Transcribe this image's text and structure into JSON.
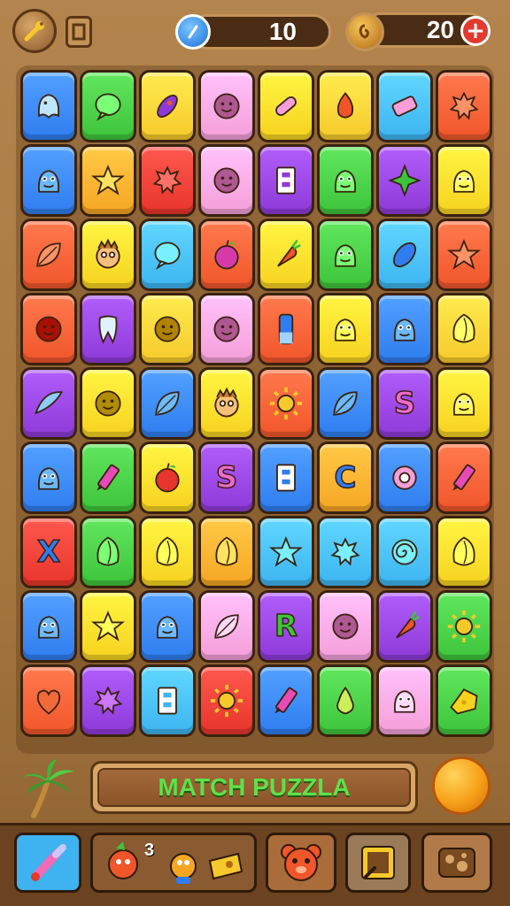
{
  "header": {
    "gems_count": "10",
    "coins_count": "20",
    "icons": [
      "wrench-icon",
      "pause-icon",
      "gem-icon",
      "coin-icon",
      "plus-icon"
    ]
  },
  "board": {
    "rows": 9,
    "cols": 8,
    "tiles": [
      [
        {
          "c": "#2f7df0",
          "i": "ghost"
        },
        {
          "c": "#3ec43a",
          "i": "bubble"
        },
        {
          "c": "#f6c92b",
          "i": "rocket"
        },
        {
          "c": "#f59ed8",
          "i": "face"
        },
        {
          "c": "#f6d21f",
          "i": "bandage"
        },
        {
          "c": "#f6c92b",
          "i": "flame"
        },
        {
          "c": "#3db4f0",
          "i": "eraser"
        },
        {
          "c": "#f0562a",
          "i": "splat"
        }
      ],
      [
        {
          "c": "#2f7df0",
          "i": "monster"
        },
        {
          "c": "#f5a623",
          "i": "star"
        },
        {
          "c": "#e8352b",
          "i": "splat"
        },
        {
          "c": "#f59ed8",
          "i": "ball"
        },
        {
          "c": "#8e3ad8",
          "i": "door"
        },
        {
          "c": "#3ec43a",
          "i": "blob"
        },
        {
          "c": "#8e3ad8",
          "i": "star4"
        },
        {
          "c": "#f6d21f",
          "i": "smile"
        }
      ],
      [
        {
          "c": "#f0562a",
          "i": "leaf"
        },
        {
          "c": "#f6d21f",
          "i": "kid"
        },
        {
          "c": "#3db4f0",
          "i": "bubble"
        },
        {
          "c": "#f0562a",
          "i": "berry"
        },
        {
          "c": "#f6d21f",
          "i": "carrot"
        },
        {
          "c": "#3ec43a",
          "i": "blob"
        },
        {
          "c": "#3db4f0",
          "i": "bean"
        },
        {
          "c": "#f0562a",
          "i": "star"
        }
      ],
      [
        {
          "c": "#f0562a",
          "i": "ball"
        },
        {
          "c": "#8e3ad8",
          "i": "tooth"
        },
        {
          "c": "#f6c92b",
          "i": "ball"
        },
        {
          "c": "#f59ed8",
          "i": "face"
        },
        {
          "c": "#f0562a",
          "i": "pill"
        },
        {
          "c": "#f6d21f",
          "i": "monster"
        },
        {
          "c": "#2f7df0",
          "i": "monster"
        },
        {
          "c": "#f6c92b",
          "i": "shell"
        }
      ],
      [
        {
          "c": "#8e3ad8",
          "i": "fish"
        },
        {
          "c": "#f6d21f",
          "i": "ball"
        },
        {
          "c": "#2f7df0",
          "i": "leaf"
        },
        {
          "c": "#f6d21f",
          "i": "lion"
        },
        {
          "c": "#f0562a",
          "i": "sun"
        },
        {
          "c": "#2f7df0",
          "i": "leaf"
        },
        {
          "c": "#8e3ad8",
          "i": "S"
        },
        {
          "c": "#f6d21f",
          "i": "monster"
        }
      ],
      [
        {
          "c": "#2f7df0",
          "i": "bird"
        },
        {
          "c": "#3ec43a",
          "i": "crayon"
        },
        {
          "c": "#f6d21f",
          "i": "apple"
        },
        {
          "c": "#8e3ad8",
          "i": "S"
        },
        {
          "c": "#2f7df0",
          "i": "door"
        },
        {
          "c": "#f5a623",
          "i": "C"
        },
        {
          "c": "#2f7df0",
          "i": "ring"
        },
        {
          "c": "#f0562a",
          "i": "crayon"
        }
      ],
      [
        {
          "c": "#e8352b",
          "i": "X"
        },
        {
          "c": "#3ec43a",
          "i": "shell"
        },
        {
          "c": "#f6d21f",
          "i": "shell"
        },
        {
          "c": "#f5a623",
          "i": "shell"
        },
        {
          "c": "#3db4f0",
          "i": "star"
        },
        {
          "c": "#3db4f0",
          "i": "flower"
        },
        {
          "c": "#3db4f0",
          "i": "spiral"
        },
        {
          "c": "#f6d21f",
          "i": "shell"
        }
      ],
      [
        {
          "c": "#2f7df0",
          "i": "blob"
        },
        {
          "c": "#f6d21f",
          "i": "star"
        },
        {
          "c": "#2f7df0",
          "i": "monster"
        },
        {
          "c": "#f59ed8",
          "i": "leaf"
        },
        {
          "c": "#8e3ad8",
          "i": "R"
        },
        {
          "c": "#f59ed8",
          "i": "ball"
        },
        {
          "c": "#8e3ad8",
          "i": "carrot"
        },
        {
          "c": "#3ec43a",
          "i": "sun"
        }
      ],
      [
        {
          "c": "#f0562a",
          "i": "heart"
        },
        {
          "c": "#8e3ad8",
          "i": "splat"
        },
        {
          "c": "#3db4f0",
          "i": "door"
        },
        {
          "c": "#e8352b",
          "i": "sun"
        },
        {
          "c": "#2f7df0",
          "i": "crayon"
        },
        {
          "c": "#3ec43a",
          "i": "pear"
        },
        {
          "c": "#f59ed8",
          "i": "monster"
        },
        {
          "c": "#3ec43a",
          "i": "cheese"
        }
      ]
    ]
  },
  "banner": {
    "text": "MATCH PUZZLA",
    "icons": [
      "palm-tree-icon",
      "orange-coin-icon"
    ]
  },
  "powerups": {
    "count_label": "3",
    "items": [
      "paintbrush-icon",
      "characters-icon",
      "bear-icon",
      "frame-icon",
      "rock-icon"
    ]
  }
}
